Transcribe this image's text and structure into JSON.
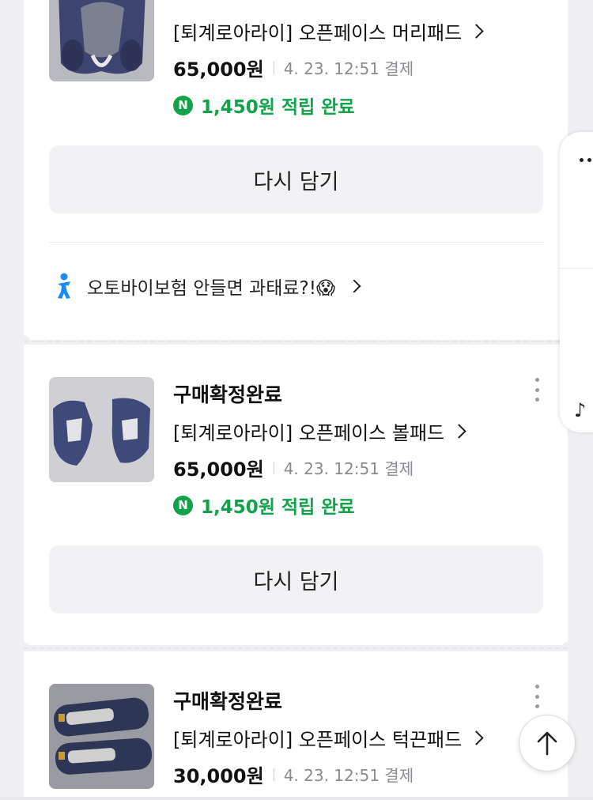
{
  "orders": [
    {
      "status": "",
      "product_name": "[퇴계로아라이] 오픈페이스 머리패드",
      "price": "65,000원",
      "paid_at": "4. 23. 12:51 결제",
      "reward": "1,450원 적립 완료",
      "rebuy_label": "다시 담기",
      "thumb_icon": "helmet-crown-pad-image"
    },
    {
      "status": "구매확정완료",
      "product_name": "[퇴계로아라이] 오픈페이스 볼패드",
      "price": "65,000원",
      "paid_at": "4. 23. 12:51 결제",
      "reward": "1,450원 적립 완료",
      "rebuy_label": "다시 담기",
      "thumb_icon": "cheek-pad-image"
    },
    {
      "status": "구매확정완료",
      "product_name": "[퇴계로아라이] 오픈페이스 턱끈패드",
      "price": "30,000원",
      "paid_at": "4. 23. 12:51 결제",
      "thumb_icon": "chin-strap-pad-image"
    }
  ],
  "insurance_banner": {
    "text": "오토바이보험 안들면 과태료?!",
    "emoji": "😱"
  },
  "reward_badge": "N",
  "side_panel": {
    "note_glyph": "♪"
  },
  "colors": {
    "reward_green": "#10a34a",
    "insurance_icon_blue": "#1b8cf2",
    "page_bg": "#f0f0f3",
    "button_bg": "#f2f2f4"
  }
}
